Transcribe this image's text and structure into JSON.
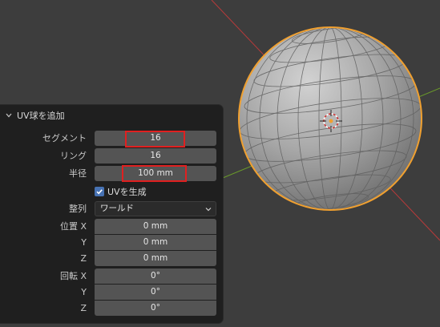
{
  "panel": {
    "title": "UV球を追加",
    "segments_label": "セグメント",
    "segments_value": "16",
    "rings_label": "リング",
    "rings_value": "16",
    "radius_label": "半径",
    "radius_value": "100 mm",
    "generate_uv_label": "UVを生成",
    "generate_uv_checked": true,
    "align_label": "整列",
    "align_value": "ワールド",
    "location_label_x": "位置 X",
    "location_label_y": "Y",
    "location_label_z": "Z",
    "location_x": "0 mm",
    "location_y": "0 mm",
    "location_z": "0 mm",
    "rotation_label_x": "回転 X",
    "rotation_label_y": "Y",
    "rotation_label_z": "Z",
    "rotation_x": "0°",
    "rotation_y": "0°",
    "rotation_z": "0°"
  },
  "colors": {
    "viewport_bg": "#3d3d3d",
    "panel_bg": "#1f1f1f",
    "field_bg": "#545454",
    "highlight": "#e02020",
    "selection_outline": "#f0a030",
    "axis_x": "#b83a3a",
    "axis_y": "#6a9a2a",
    "checkbox": "#4772b3"
  },
  "icons": {
    "collapse": "chevron-down-icon",
    "dropdown": "chevron-down-icon",
    "checkbox": "checkmark-icon",
    "origin": "3d-cursor-icon"
  }
}
